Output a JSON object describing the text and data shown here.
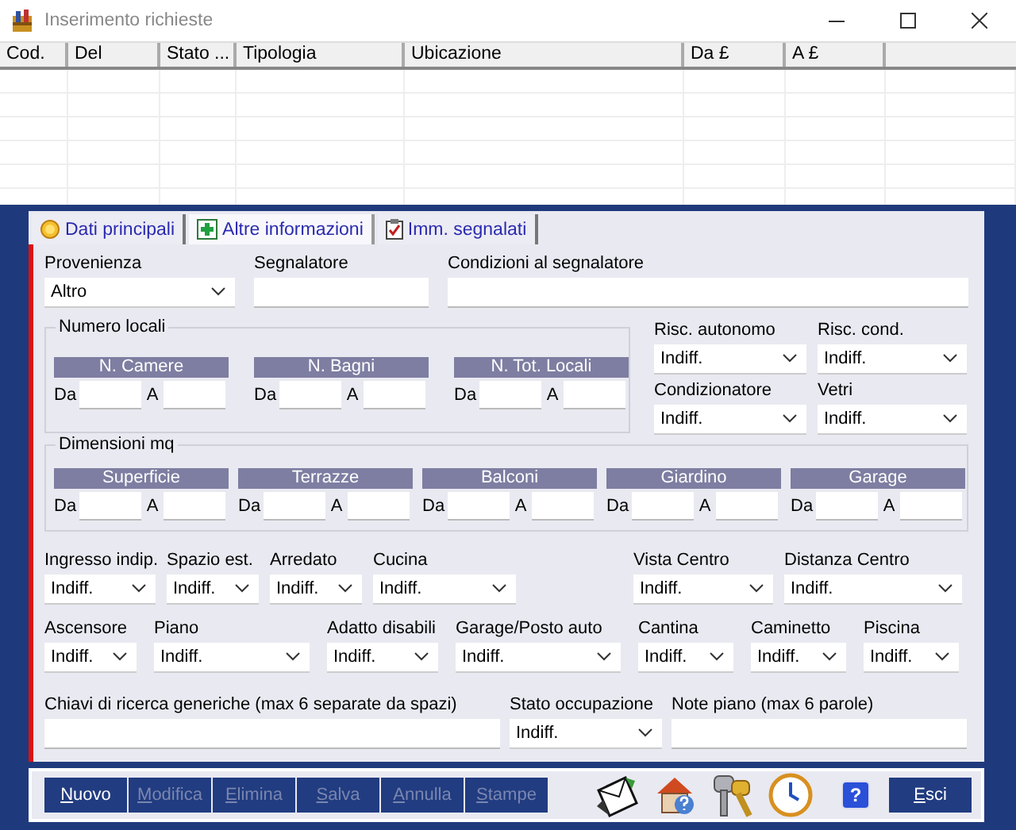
{
  "window": {
    "title": "Inserimento richieste"
  },
  "table": {
    "columns": [
      "Cod.",
      "Del",
      "Stato ...",
      "Tipologia",
      "Ubicazione",
      "Da £",
      "A £"
    ]
  },
  "tabs": [
    {
      "label": "Dati principali",
      "selected": false
    },
    {
      "label": "Altre informazioni",
      "selected": true
    },
    {
      "label": "Imm. segnalati",
      "selected": false
    }
  ],
  "top_fields": [
    {
      "label": "Provenienza",
      "kind": "select",
      "value": "Altro"
    },
    {
      "label": "Segnalatore",
      "kind": "input"
    },
    {
      "label": "Condizioni al segnalatore",
      "kind": "input"
    }
  ],
  "numero_locali": {
    "title": "Numero locali",
    "ranges": [
      {
        "title": "N. Camere",
        "from": "Da",
        "to": "A"
      },
      {
        "title": "N. Bagni",
        "from": "Da",
        "to": "A"
      },
      {
        "title": "N. Tot. Locali",
        "from": "Da",
        "to": "A"
      }
    ]
  },
  "side_fields": [
    {
      "label": "Risc. autonomo",
      "kind": "select",
      "value": "Indiff."
    },
    {
      "label": "Risc. cond.",
      "kind": "select",
      "value": "Indiff."
    },
    {
      "label": "Condizionatore",
      "kind": "select",
      "value": "Indiff."
    },
    {
      "label": "Vetri",
      "kind": "select",
      "value": "Indiff."
    }
  ],
  "dimensioni": {
    "title": "Dimensioni mq",
    "ranges": [
      {
        "title": "Superficie",
        "from": "Da",
        "to": "A"
      },
      {
        "title": "Terrazze",
        "from": "Da",
        "to": "A"
      },
      {
        "title": "Balconi",
        "from": "Da",
        "to": "A"
      },
      {
        "title": "Giardino",
        "from": "Da",
        "to": "A"
      },
      {
        "title": "Garage",
        "from": "Da",
        "to": "A"
      }
    ]
  },
  "row_1": [
    {
      "label": "Ingresso indip.",
      "kind": "select",
      "value": "Indiff."
    },
    {
      "label": "Spazio est.",
      "kind": "select",
      "value": "Indiff."
    },
    {
      "label": "Arredato",
      "kind": "select",
      "value": "Indiff."
    },
    {
      "label": "Cucina",
      "kind": "select",
      "value": "Indiff."
    },
    {
      "label": "Vista Centro",
      "kind": "select",
      "value": "Indiff."
    },
    {
      "label": "Distanza Centro",
      "kind": "select",
      "value": "Indiff."
    }
  ],
  "row_2": [
    {
      "label": "Ascensore",
      "kind": "select",
      "value": "Indiff."
    },
    {
      "label": "Piano",
      "kind": "select",
      "value": "Indiff."
    },
    {
      "label": "Adatto disabili",
      "kind": "select",
      "value": "Indiff."
    },
    {
      "label": "Garage/Posto auto",
      "kind": "select",
      "value": "Indiff."
    },
    {
      "label": "Cantina",
      "kind": "select",
      "value": "Indiff."
    },
    {
      "label": "Caminetto",
      "kind": "select",
      "value": "Indiff."
    },
    {
      "label": "Piscina",
      "kind": "select",
      "value": "Indiff."
    }
  ],
  "row_3": [
    {
      "label": "Chiavi di ricerca generiche (max 6 separate da spazi)",
      "kind": "input"
    },
    {
      "label": "Stato occupazione",
      "kind": "select",
      "value": "Indiff."
    },
    {
      "label": "Note piano (max 6 parole)",
      "kind": "input"
    }
  ],
  "buttons": [
    {
      "label": "Nuovo",
      "disabled": false
    },
    {
      "label": "Modifica",
      "disabled": true
    },
    {
      "label": "Elimina",
      "disabled": true
    },
    {
      "label": "Salva",
      "disabled": true
    },
    {
      "label": "Annulla",
      "disabled": true
    },
    {
      "label": "Stampe",
      "disabled": true
    }
  ],
  "help_button": {
    "glyph": "?"
  },
  "exit_button": {
    "label": "Esci"
  }
}
